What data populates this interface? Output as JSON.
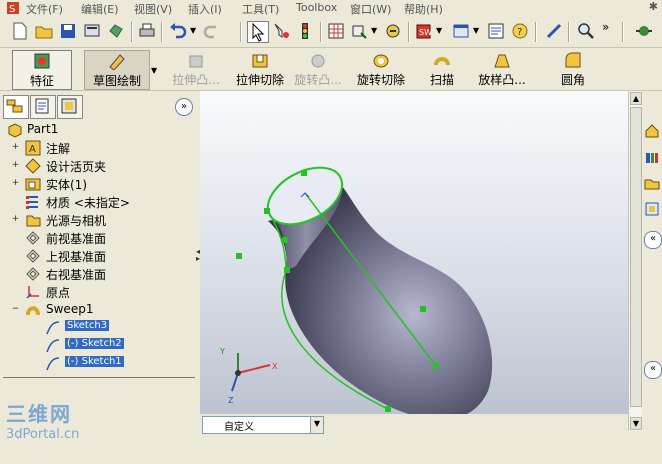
{
  "menu": {
    "items": [
      "文件(F)",
      "编辑(E)",
      "视图(V)",
      "插入(I)",
      "工具(T)",
      "Toolbox",
      "窗口(W)",
      "帮助(H)"
    ],
    "pin": "✱"
  },
  "toolbar2": {
    "feature": "特征",
    "sketch": "草图绘制",
    "extrude_boss": "拉伸凸...",
    "extrude_cut": "拉伸切除",
    "revolve_boss": "旋转凸...",
    "revolve_cut": "旋转切除",
    "sweep": "扫描",
    "loft": "放样凸...",
    "fillet": "圆角"
  },
  "tree": {
    "root": "Part1",
    "items": [
      {
        "label": "注解",
        "expand": "+"
      },
      {
        "label": "设计活页夹",
        "expand": "+"
      },
      {
        "label": "实体(1)",
        "expand": "+"
      },
      {
        "label": "材质 <未指定>",
        "expand": ""
      },
      {
        "label": "光源与相机",
        "expand": "+"
      },
      {
        "label": "前视基准面",
        "expand": ""
      },
      {
        "label": "上视基准面",
        "expand": ""
      },
      {
        "label": "右视基准面",
        "expand": ""
      },
      {
        "label": "原点",
        "expand": ""
      },
      {
        "label": "Sweep1",
        "expand": "−"
      },
      {
        "label": "Sketch3",
        "expand": ""
      },
      {
        "label": "(-) Sketch2",
        "expand": ""
      },
      {
        "label": "(-) Sketch1",
        "expand": ""
      }
    ]
  },
  "view_combo": {
    "value": "自定义"
  },
  "triad": {
    "x": "X",
    "y": "Y",
    "z": "Z"
  },
  "watermark": {
    "line1": "三维网",
    "line2": "3dPortal.cn"
  },
  "colors": {
    "selection": "#316ac5",
    "sketch_green": "#22c322",
    "part_body": "#6f6e88"
  }
}
